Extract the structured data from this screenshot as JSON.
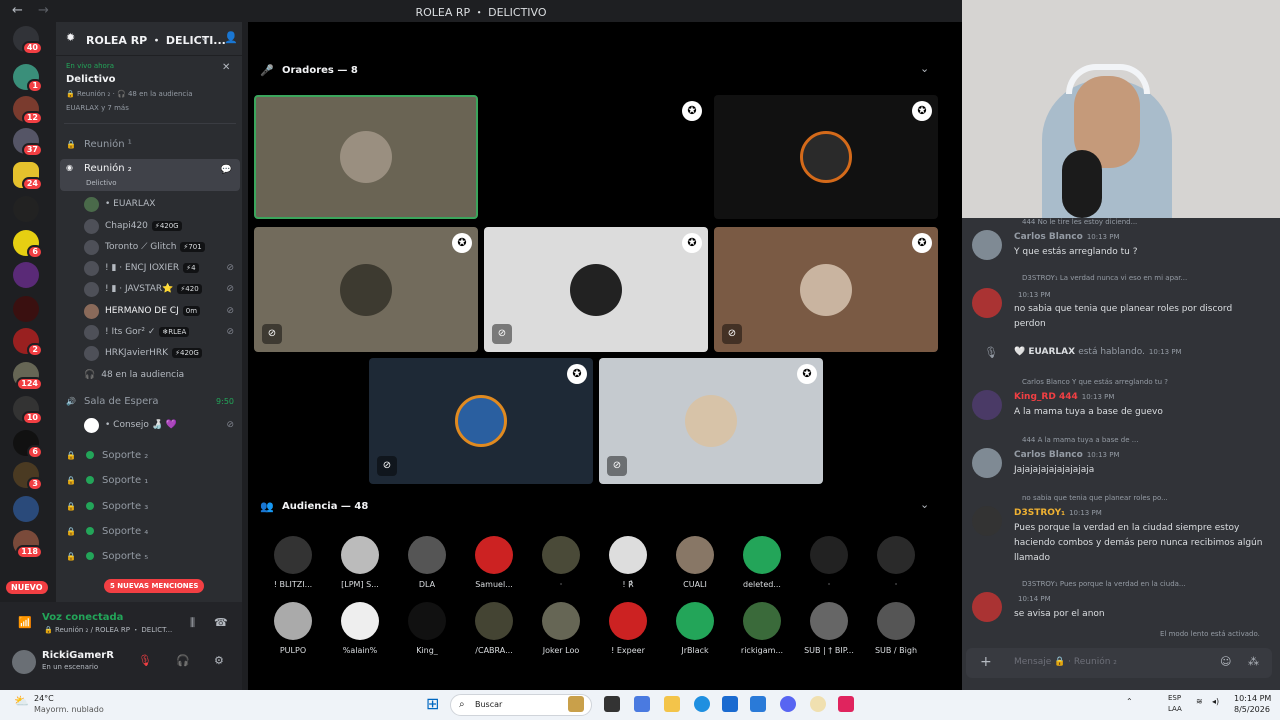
{
  "window": {
    "title": "ROLEA RP ・ DELICTIVO"
  },
  "rail": {
    "badges": [
      "40",
      "1",
      "12",
      "37",
      "24",
      "6",
      "4",
      "2",
      "124",
      "10",
      "6",
      "3",
      "118"
    ],
    "nuevo": "NUEVO"
  },
  "server": {
    "name": "ROLEA RP ・ DELICTI...",
    "live_label": "En vivo ahora",
    "stage_name": "Delictivo",
    "stage_meta": "🔒 Reunión ₂ · 🎧 48 en la audiencia",
    "stage_members": "EUARLAX y 7 más"
  },
  "channels": {
    "reunion1": "Reunión ¹",
    "reunion2": "Reunión ₂",
    "reunion2_sub": "Delictivo",
    "members": [
      {
        "name": "• EUARLAX",
        "tag": ""
      },
      {
        "name": "Chapi420",
        "tag": "⚡420G"
      },
      {
        "name": "Toronto ⟋ Glitch",
        "tag": "⚡701"
      },
      {
        "name": "! ▮ · ENCJ IOXIER",
        "tag": "⚡4"
      },
      {
        "name": "! ▮ · JAVSTAR⭐",
        "tag": "⚡420"
      },
      {
        "name": "HERMANO DE CJ",
        "tag": "0m"
      },
      {
        "name": "! Its Gor² ✓",
        "tag": "❄RLEA"
      },
      {
        "name": "HRKJavierHRK",
        "tag": "⚡420G"
      }
    ],
    "audience": "48 en la audiencia",
    "espera": "Sala de Espera",
    "espera_time": "9:50",
    "espera_member": "• Consejo 🍶 💜",
    "soportes": [
      "Soporte ₂",
      "Soporte ₁",
      "Soporte ₃",
      "Soporte ₄",
      "Soporte ₅"
    ],
    "mentions": "5 NUEVAS MENCIONES"
  },
  "voice": {
    "status": "Voz conectada",
    "sub": "🔒 Reunión ₂ / ROLEA RP ・ DELICT...",
    "username": "RickiGamerR",
    "user_status": "En un escenario"
  },
  "stage": {
    "speakers_header": "Oradores — 8",
    "audience_header": "Audiencia — 48",
    "audience": [
      {
        "name": "! BLITZI..."
      },
      {
        "name": "[LPM] S..."
      },
      {
        "name": "DLA"
      },
      {
        "name": "Samuel..."
      },
      {
        "name": "·"
      },
      {
        "name": "!  ℟"
      },
      {
        "name": "CUALI"
      },
      {
        "name": "deleted..."
      },
      {
        "name": "·"
      },
      {
        "name": "·"
      },
      {
        "name": "PULPO"
      },
      {
        "name": "%alain%"
      },
      {
        "name": "King_"
      },
      {
        "name": "/CABRA..."
      },
      {
        "name": "Joker Loo"
      },
      {
        "name": "! Expeer"
      },
      {
        "name": "JrBlack"
      },
      {
        "name": "rickigam..."
      },
      {
        "name": "SUB | † BIP..."
      },
      {
        "name": "SUB / Bigh"
      }
    ]
  },
  "chat": {
    "messages": [
      {
        "reply": "444  No le tire les estoy diciend...",
        "author": "Carlos Blanco",
        "author_color": "#949ba4",
        "time": "10:13 PM",
        "text": "Y que estás arreglando tu ?"
      },
      {
        "reply": "D3STROY₁  La verdad nunca vi eso en mi apar...",
        "author": "",
        "time": "10:13 PM",
        "text": "no sabia que tenia que planear roles por discord perdon"
      },
      {
        "reply": "",
        "author": "🤍 EUARLAX",
        "author_color": "#dbdee1",
        "time": "10:13 PM",
        "text": "está hablando."
      },
      {
        "reply": "Carlos Blanco  Y que estás arreglando tu ?",
        "author": "King_RD  444",
        "author_color": "#f23f43",
        "time": "10:13 PM",
        "text": "A la mama tuya a base de guevo"
      },
      {
        "reply": "444  A la mama tuya a base de ...",
        "author": "Carlos Blanco",
        "author_color": "#949ba4",
        "time": "10:13 PM",
        "text": "Jajajajajajajajajaja"
      },
      {
        "reply": "no sabia que tenia que planear roles po...",
        "author": "D3STROY₁",
        "author_color": "#f0b232",
        "time": "10:13 PM",
        "text": "Pues porque la verdad en la ciudad siempre estoy haciendo combos y demás pero nunca recibimos algún llamado"
      },
      {
        "reply": "D3STROY₁  Pues porque la verdad en la ciuda...",
        "author": "",
        "time": "10:14 PM",
        "text": "se avisa por el anon"
      }
    ],
    "slowmode": "El modo lento está activado.",
    "placeholder": "Mensaje 🔒 · Reunión ₂"
  },
  "taskbar": {
    "weather_temp": "24°C",
    "weather_desc": "Mayorm. nublado",
    "search": "Buscar",
    "lang": "ESP",
    "lang2": "LAA",
    "time": "10:14 PM",
    "date": "8/5/2026"
  }
}
